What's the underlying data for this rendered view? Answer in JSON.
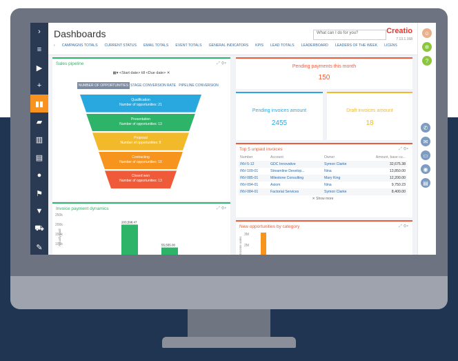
{
  "header": {
    "title": "Dashboards",
    "search_placeholder": "What can I do for you?",
    "logo": "Creatio",
    "version": "7.13.1.168"
  },
  "tabs": [
    "CAMPAIGNS TOTALS",
    "CURRENT STATUS",
    "EMAIL TOTALS",
    "EVENT TOTALS",
    "GENERAL INDICATORS",
    "KPIS",
    "LEAD TOTALS",
    "LEADERBOARD",
    "LEADERS OF THE WEEK",
    "LICENSES"
  ],
  "sales_pipeline": {
    "title": "Sales pipeline",
    "date_range": "<Start date> till <Due date>",
    "buttons": [
      "NUMBER OF OPPORTUNITIES",
      "STAGE CONVERSION RATE",
      "PIPELINE CONVERSION"
    ],
    "stages": [
      {
        "name": "Qualification",
        "label": "Number of opportunities: 21",
        "color": "#29a8e0"
      },
      {
        "name": "Presentation",
        "label": "Number of opportunities: 13",
        "color": "#2db468"
      },
      {
        "name": "Proposal",
        "label": "Number of opportunities: 8",
        "color": "#f2b92a"
      },
      {
        "name": "Contracting",
        "label": "Number of opportunities: 10",
        "color": "#f7941d"
      },
      {
        "name": "Closed won",
        "label": "Number of opportunities: 13",
        "color": "#ef5a38"
      }
    ]
  },
  "pending_payments": {
    "title": "Pending payments this month",
    "value": "150"
  },
  "pending_invoices": {
    "title": "Pending invoices amount",
    "value": "2455"
  },
  "draft_invoices": {
    "title": "Draft invoices amount",
    "value": "18"
  },
  "top_unpaid": {
    "title": "Top 5 unpaid invoices",
    "columns": [
      "Number",
      "Account",
      "Owner",
      "Amount, base cu..."
    ],
    "rows": [
      [
        "INV-5-12",
        "GDC Innovative",
        "Symon Clarke",
        "32,675.38"
      ],
      [
        "INV-109-01",
        "Streamline Develop...",
        "Nina",
        "13,850.00"
      ],
      [
        "INV-085-01",
        "Milestone Consulting",
        "Mary King",
        "12,200.00"
      ],
      [
        "INV-094-01",
        "Axiom",
        "Nina",
        "9,750.23"
      ],
      [
        "INV-084-01",
        "Factorial Services",
        "Symon Clarke",
        "8,400.00"
      ]
    ],
    "show_more": "Show more"
  },
  "invoice_dynamics": {
    "title": "Invoice payment dynamics",
    "chart_data": {
      "type": "bar",
      "categories": [
        "",
        ""
      ],
      "values": [
        203598.47,
        55555
      ],
      "value_labels": [
        "203,598.47",
        "55,555.00"
      ],
      "yticks": [
        "250k",
        "200k",
        "150k",
        "100k"
      ],
      "ylabel": "Actually paid",
      "ylim": [
        0,
        250000
      ]
    }
  },
  "new_opps": {
    "title": "New opportunities by category",
    "chart_data": {
      "type": "bar",
      "categories": [
        ""
      ],
      "values": [
        3000
      ],
      "yticks": [
        "3M",
        "2M"
      ],
      "ylabel": "Income sales"
    }
  }
}
